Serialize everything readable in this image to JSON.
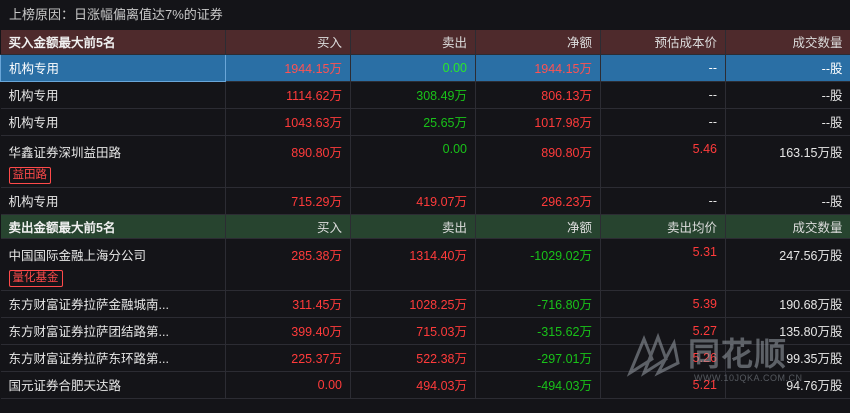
{
  "reason": "上榜原因：日涨幅偏离值达7%的证券",
  "buy_section": {
    "headers": [
      "买入金额最大前5名",
      "买入",
      "卖出",
      "净额",
      "预估成本价",
      "成交数量"
    ],
    "rows": [
      {
        "name": "机构专用",
        "buy": "1944.15万",
        "sell": "0.00",
        "net": "1944.15万",
        "price": "--",
        "volume": "--股",
        "tag": ""
      },
      {
        "name": "机构专用",
        "buy": "1114.62万",
        "sell": "308.49万",
        "net": "806.13万",
        "price": "--",
        "volume": "--股",
        "tag": ""
      },
      {
        "name": "机构专用",
        "buy": "1043.63万",
        "sell": "25.65万",
        "net": "1017.98万",
        "price": "--",
        "volume": "--股",
        "tag": ""
      },
      {
        "name": "华鑫证券深圳益田路",
        "buy": "890.80万",
        "sell": "0.00",
        "net": "890.80万",
        "price": "5.46",
        "volume": "163.15万股",
        "tag": "益田路"
      },
      {
        "name": "机构专用",
        "buy": "715.29万",
        "sell": "419.07万",
        "net": "296.23万",
        "price": "--",
        "volume": "--股",
        "tag": ""
      }
    ]
  },
  "sell_section": {
    "headers": [
      "卖出金额最大前5名",
      "买入",
      "卖出",
      "净额",
      "卖出均价",
      "成交数量"
    ],
    "rows": [
      {
        "name": "中国国际金融上海分公司",
        "buy": "285.38万",
        "sell": "1314.40万",
        "net": "-1029.02万",
        "price": "5.31",
        "volume": "247.56万股",
        "tag": "量化基金"
      },
      {
        "name": "东方财富证券拉萨金融城南...",
        "buy": "311.45万",
        "sell": "1028.25万",
        "net": "-716.80万",
        "price": "5.39",
        "volume": "190.68万股",
        "tag": ""
      },
      {
        "name": "东方财富证券拉萨团结路第...",
        "buy": "399.40万",
        "sell": "715.03万",
        "net": "-315.62万",
        "price": "5.27",
        "volume": "135.80万股",
        "tag": ""
      },
      {
        "name": "东方财富证券拉萨东环路第...",
        "buy": "225.37万",
        "sell": "522.38万",
        "net": "-297.01万",
        "price": "5.26",
        "volume": "99.35万股",
        "tag": ""
      },
      {
        "name": "国元证券合肥天达路",
        "buy": "0.00",
        "sell": "494.03万",
        "net": "-494.03万",
        "price": "5.21",
        "volume": "94.76万股",
        "tag": ""
      }
    ]
  },
  "watermark": {
    "brand": "同花顺",
    "url": "WWW.10JQKA.COM.CN"
  },
  "colors": {
    "up": "#ff3b3b",
    "down": "#19c219",
    "buy_header_bg": "#4e2a2c",
    "sell_header_bg": "#27442f",
    "selected_row_bg": "#2a6fa5"
  }
}
